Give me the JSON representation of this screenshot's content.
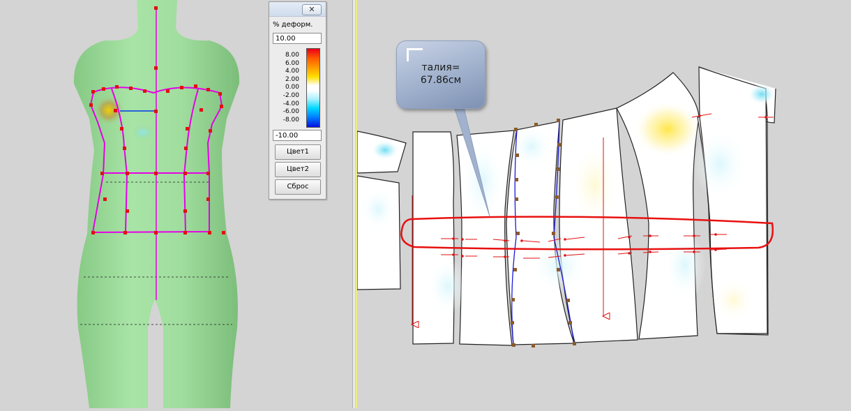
{
  "deform_panel": {
    "close_label": "✕",
    "percent_label": "% деформ.",
    "percent_value": "10.00",
    "scale_values": [
      "8.00",
      "6.00",
      "4.00",
      "2.00",
      "0.00",
      "-2.00",
      "-4.00",
      "-6.00",
      "-8.00"
    ],
    "min_value": "-10.00",
    "color1_button": "Цвет1",
    "color2_button": "Цвет2",
    "reset_button": "Сброс"
  },
  "callout": {
    "line1": "талия=",
    "line2": "67.86см"
  },
  "colors": {
    "mannequin": "#9cd99a",
    "garment_outline": "#e600e6",
    "waist_line": "#ff1a1a",
    "seam_line": "#1a1ad6",
    "splitter_accent": "#f2f200"
  }
}
